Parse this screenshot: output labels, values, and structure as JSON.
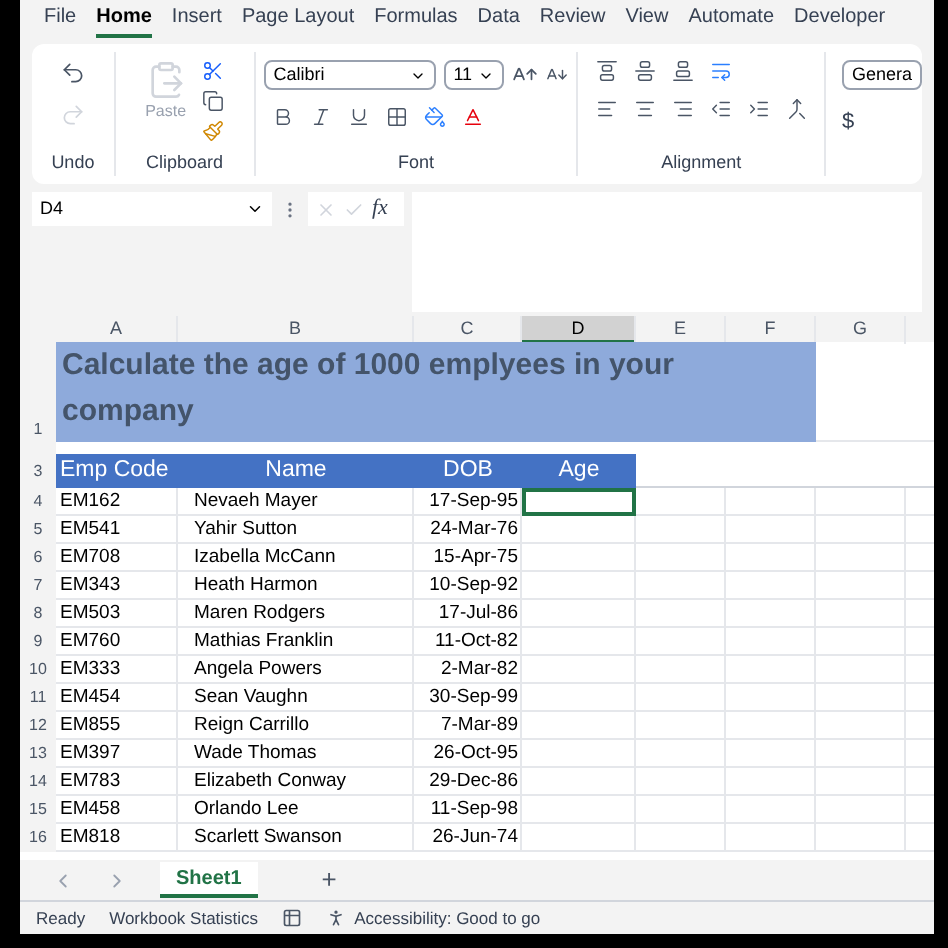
{
  "ribbon": {
    "tabs": [
      {
        "label": "File",
        "selected": false
      },
      {
        "label": "Home",
        "selected": true
      },
      {
        "label": "Insert",
        "selected": false
      },
      {
        "label": "Page Layout",
        "selected": false
      },
      {
        "label": "Formulas",
        "selected": false
      },
      {
        "label": "Data",
        "selected": false
      },
      {
        "label": "Review",
        "selected": false
      },
      {
        "label": "View",
        "selected": false
      },
      {
        "label": "Automate",
        "selected": false
      },
      {
        "label": "Developer",
        "selected": false
      }
    ],
    "paste_label": "Paste",
    "font_name": "Calibri",
    "font_size": "11",
    "number_format": "Genera",
    "currency": "$",
    "group_labels": [
      "Undo",
      "Clipboard",
      "Font",
      "Alignment"
    ]
  },
  "formula_bar": {
    "name_box": "D4",
    "fx": "fx"
  },
  "sheet": {
    "columns": [
      {
        "label": "A",
        "selected": false
      },
      {
        "label": "B",
        "selected": false
      },
      {
        "label": "C",
        "selected": false
      },
      {
        "label": "D",
        "selected": true
      },
      {
        "label": "E",
        "selected": false
      },
      {
        "label": "F",
        "selected": false
      },
      {
        "label": "G",
        "selected": false
      }
    ],
    "title": {
      "row": "1",
      "text": "Calculate the age of 1000 emplyees in your company"
    },
    "header": {
      "row": "3",
      "cells": [
        "Emp Code",
        "Name",
        "DOB",
        "Age"
      ]
    },
    "rows": [
      {
        "row": "4",
        "code": "EM162",
        "name": "Nevaeh Mayer",
        "dob": "17-Sep-95",
        "selected": true
      },
      {
        "row": "5",
        "code": "EM541",
        "name": "Yahir Sutton",
        "dob": "24-Mar-76",
        "selected": false
      },
      {
        "row": "6",
        "code": "EM708",
        "name": "Izabella McCann",
        "dob": "15-Apr-75",
        "selected": false
      },
      {
        "row": "7",
        "code": "EM343",
        "name": "Heath Harmon",
        "dob": "10-Sep-92",
        "selected": false
      },
      {
        "row": "8",
        "code": "EM503",
        "name": "Maren Rodgers",
        "dob": "17-Jul-86",
        "selected": false
      },
      {
        "row": "9",
        "code": "EM760",
        "name": "Mathias Franklin",
        "dob": "11-Oct-82",
        "selected": false
      },
      {
        "row": "10",
        "code": "EM333",
        "name": "Angela Powers",
        "dob": "2-Mar-82",
        "selected": false
      },
      {
        "row": "11",
        "code": "EM454",
        "name": "Sean Vaughn",
        "dob": "30-Sep-99",
        "selected": false
      },
      {
        "row": "12",
        "code": "EM855",
        "name": "Reign Carrillo",
        "dob": "7-Mar-89",
        "selected": false
      },
      {
        "row": "13",
        "code": "EM397",
        "name": "Wade Thomas",
        "dob": "26-Oct-95",
        "selected": false
      },
      {
        "row": "14",
        "code": "EM783",
        "name": "Elizabeth Conway",
        "dob": "29-Dec-86",
        "selected": false
      },
      {
        "row": "15",
        "code": "EM458",
        "name": "Orlando Lee",
        "dob": "11-Sep-98",
        "selected": false
      },
      {
        "row": "16",
        "code": "EM818",
        "name": "Scarlett Swanson",
        "dob": "26-Jun-74",
        "selected": false
      }
    ]
  },
  "sheet_tabs": [
    {
      "label": "Sheet1",
      "selected": true
    }
  ],
  "add_sheet": "+",
  "status_bar": [
    "Ready",
    "Workbook Statistics",
    "Accessibility: Good to go"
  ]
}
